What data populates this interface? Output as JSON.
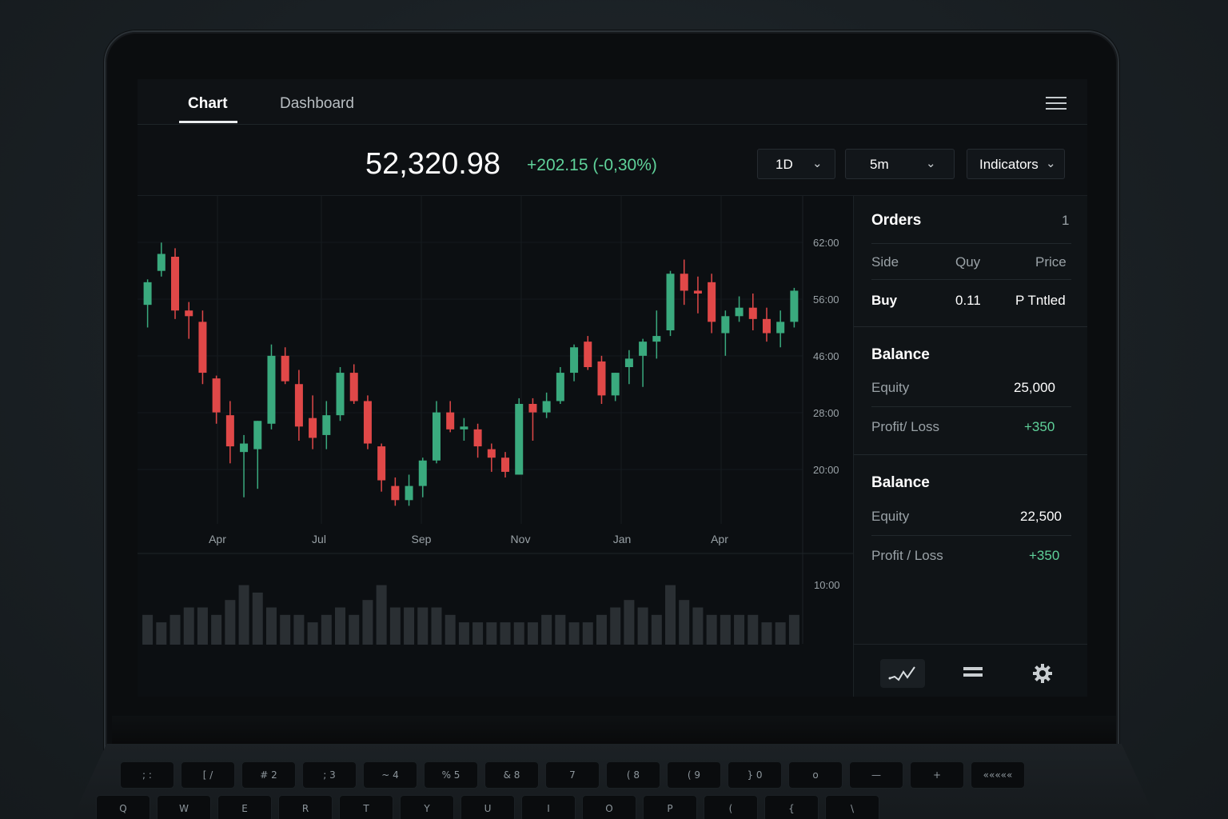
{
  "nav": {
    "tabs": [
      {
        "label": "Chart",
        "active": true
      },
      {
        "label": "Dashboard",
        "active": false
      }
    ],
    "menu_icon": "hamburger-icon"
  },
  "header": {
    "price": "52,320.98",
    "change": "+202.15",
    "change_pct": "(-0,30%)",
    "range_select": "1D",
    "interval_select": "5m",
    "indicators_label": "Indicators"
  },
  "orders": {
    "title": "Orders",
    "count": "1",
    "columns": [
      "Side",
      "Quy",
      "Price"
    ],
    "rows": [
      {
        "side": "Buy",
        "qty": "0.11",
        "price": "P Tntled"
      }
    ]
  },
  "balance_1": {
    "title": "Balance",
    "equity_label": "Equity",
    "equity_value": "25,000",
    "pl_label": "Profit/ Loss",
    "pl_value": "+350"
  },
  "balance_2": {
    "title": "Balance",
    "equity_label": "Equity",
    "equity_value": "22,500",
    "pl_label": "Profit / Loss",
    "pl_value": "+350"
  },
  "bottom_icons": [
    "line-chart-icon",
    "list-icon",
    "gear-icon"
  ],
  "colors": {
    "up": "#3aaa7e",
    "down": "#e04848",
    "accent_green": "#5fd29a"
  },
  "keyboard": {
    "row1": [
      "; :",
      "[ /",
      "# 2",
      "; 3",
      "~ 4",
      "% 5",
      "& 8",
      "7",
      "( 8",
      "( 9",
      "} 0",
      "o",
      "—",
      "+",
      "«««««"
    ],
    "row2": [
      "Q",
      "W",
      "E",
      "R",
      "T",
      "Y",
      "U",
      "I",
      "O",
      "P",
      "(",
      "{",
      "\\"
    ]
  },
  "chart_data": {
    "type": "candlestick",
    "x_ticks": [
      "Apr",
      "Jul",
      "Sep",
      "Nov",
      "Jan",
      "Apr"
    ],
    "y_ticks": [
      "62:00",
      "56:00",
      "46:00",
      "28:00",
      "20:00"
    ],
    "volume_tick": "10:00",
    "candles": [
      {
        "o": 47.0,
        "h": 51.5,
        "l": 43.0,
        "c": 51.0
      },
      {
        "o": 53.0,
        "h": 58.0,
        "l": 52.0,
        "c": 56.0
      },
      {
        "o": 55.5,
        "h": 57.0,
        "l": 44.5,
        "c": 46.0
      },
      {
        "o": 46.0,
        "h": 47.5,
        "l": 41.0,
        "c": 45.0
      },
      {
        "o": 44.0,
        "h": 46.0,
        "l": 33.0,
        "c": 35.0
      },
      {
        "o": 34.0,
        "h": 34.5,
        "l": 26.0,
        "c": 28.0
      },
      {
        "o": 27.5,
        "h": 30.0,
        "l": 19.0,
        "c": 22.0
      },
      {
        "o": 21.0,
        "h": 24.0,
        "l": 13.0,
        "c": 22.5
      },
      {
        "o": 21.5,
        "h": 26.5,
        "l": 14.5,
        "c": 26.5
      },
      {
        "o": 26.0,
        "h": 40.0,
        "l": 25.0,
        "c": 38.0
      },
      {
        "o": 38.0,
        "h": 39.5,
        "l": 33.0,
        "c": 33.5
      },
      {
        "o": 33.0,
        "h": 35.5,
        "l": 23.0,
        "c": 25.5
      },
      {
        "o": 27.0,
        "h": 31.0,
        "l": 21.5,
        "c": 23.5
      },
      {
        "o": 24.0,
        "h": 30.0,
        "l": 21.5,
        "c": 27.5
      },
      {
        "o": 27.5,
        "h": 36.0,
        "l": 26.5,
        "c": 35.0
      },
      {
        "o": 35.0,
        "h": 36.5,
        "l": 29.5,
        "c": 30.0
      },
      {
        "o": 30.0,
        "h": 31.0,
        "l": 21.5,
        "c": 22.5
      },
      {
        "o": 22.0,
        "h": 22.5,
        "l": 14.0,
        "c": 16.0
      },
      {
        "o": 15.0,
        "h": 16.5,
        "l": 11.5,
        "c": 12.5
      },
      {
        "o": 12.5,
        "h": 17.0,
        "l": 11.5,
        "c": 15.0
      },
      {
        "o": 15.0,
        "h": 20.0,
        "l": 13.0,
        "c": 19.5
      },
      {
        "o": 19.5,
        "h": 30.0,
        "l": 19.0,
        "c": 28.0
      },
      {
        "o": 28.0,
        "h": 30.0,
        "l": 24.5,
        "c": 25.0
      },
      {
        "o": 25.0,
        "h": 27.0,
        "l": 23.0,
        "c": 25.5
      },
      {
        "o": 25.0,
        "h": 26.0,
        "l": 20.0,
        "c": 22.0
      },
      {
        "o": 21.5,
        "h": 22.5,
        "l": 17.5,
        "c": 20.0
      },
      {
        "o": 20.0,
        "h": 21.0,
        "l": 16.5,
        "c": 17.5
      },
      {
        "o": 17.0,
        "h": 30.5,
        "l": 17.0,
        "c": 29.5
      },
      {
        "o": 29.5,
        "h": 30.5,
        "l": 23.0,
        "c": 28.0
      },
      {
        "o": 28.0,
        "h": 31.5,
        "l": 27.0,
        "c": 30.0
      },
      {
        "o": 30.0,
        "h": 36.0,
        "l": 29.5,
        "c": 35.0
      },
      {
        "o": 35.0,
        "h": 40.0,
        "l": 33.5,
        "c": 39.5
      },
      {
        "o": 40.5,
        "h": 41.5,
        "l": 35.5,
        "c": 36.0
      },
      {
        "o": 37.0,
        "h": 38.0,
        "l": 29.5,
        "c": 31.0
      },
      {
        "o": 31.0,
        "h": 35.0,
        "l": 30.0,
        "c": 35.0
      },
      {
        "o": 36.0,
        "h": 39.0,
        "l": 33.0,
        "c": 37.5
      },
      {
        "o": 38.0,
        "h": 41.0,
        "l": 32.5,
        "c": 40.5
      },
      {
        "o": 40.5,
        "h": 46.0,
        "l": 37.5,
        "c": 41.5
      },
      {
        "o": 42.5,
        "h": 53.0,
        "l": 41.5,
        "c": 52.5
      },
      {
        "o": 52.5,
        "h": 55.0,
        "l": 47.0,
        "c": 49.5
      },
      {
        "o": 49.5,
        "h": 52.0,
        "l": 45.5,
        "c": 49.0
      },
      {
        "o": 51.0,
        "h": 52.5,
        "l": 42.0,
        "c": 44.0
      },
      {
        "o": 42.0,
        "h": 46.0,
        "l": 38.0,
        "c": 45.0
      },
      {
        "o": 45.0,
        "h": 48.5,
        "l": 44.0,
        "c": 46.5
      },
      {
        "o": 46.5,
        "h": 49.0,
        "l": 42.5,
        "c": 44.5
      },
      {
        "o": 44.5,
        "h": 46.5,
        "l": 40.5,
        "c": 42.0
      },
      {
        "o": 42.0,
        "h": 46.0,
        "l": 39.5,
        "c": 44.0
      },
      {
        "o": 44.0,
        "h": 50.0,
        "l": 43.0,
        "c": 49.5
      }
    ],
    "volumes": [
      4,
      3,
      4,
      5,
      5,
      4,
      6,
      8,
      7,
      5,
      4,
      4,
      3,
      4,
      5,
      4,
      6,
      8,
      5,
      5,
      5,
      5,
      4,
      3,
      3,
      3,
      3,
      3,
      3,
      4,
      4,
      3,
      3,
      4,
      5,
      6,
      5,
      4,
      8,
      6,
      5,
      4,
      4,
      4,
      4,
      3,
      3,
      4
    ]
  }
}
